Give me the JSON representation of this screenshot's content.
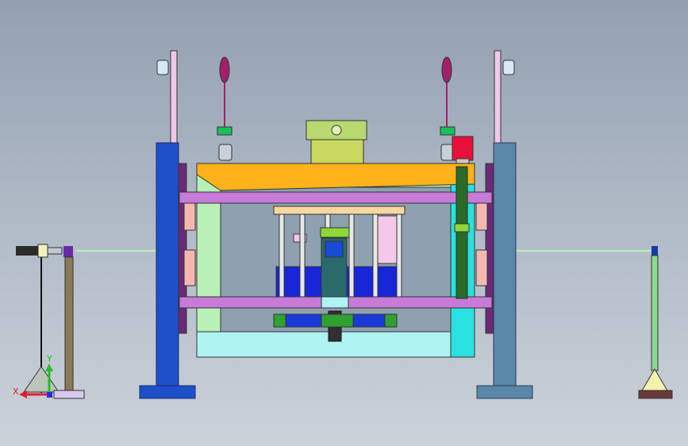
{
  "viewport": {
    "background_top": "#93a0b1",
    "background_bottom": "#cbd1d9"
  },
  "triad": {
    "x_label": "X",
    "y_label": "Y",
    "x_color": "#e0202a",
    "y_color": "#22c02a",
    "z_color": "#2030e0"
  },
  "colors": {
    "pillar_left": "#1f4fc8",
    "pillar_right": "#5a86a8",
    "lift_beam": "#ffb21a",
    "crossbar": "#c77ad8",
    "tray_frame": "#b8f0b8",
    "tray_bottom": "#aef2f2",
    "battery_blue": "#1826d8",
    "pink_plate": "#f4c8e8",
    "guide_rod": "#b8f0b8"
  }
}
